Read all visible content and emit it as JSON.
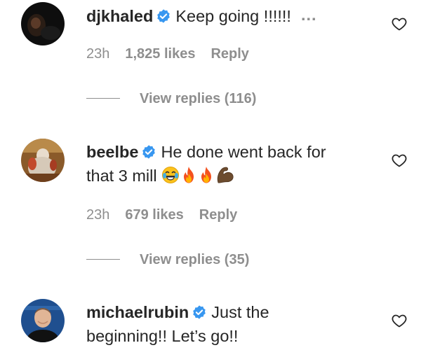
{
  "colors": {
    "text": "#262626",
    "secondary": "#8e8e8e",
    "verified": "#3897f0"
  },
  "comments": [
    {
      "username": "djkhaled",
      "verified": true,
      "text": "Keep going !!!!!!",
      "more": "...",
      "time": "23h",
      "likes": "1,825 likes",
      "reply": "Reply",
      "view_replies": "View replies (116)",
      "heart_icon": "heart-outline-icon"
    },
    {
      "username": "beelbe",
      "verified": true,
      "text_line1": "He done went back for",
      "text_line2": "that 3 mill",
      "emojis": [
        "face-with-tears-of-joy",
        "fire",
        "fire",
        "flexed-biceps"
      ],
      "time": "23h",
      "likes": "679 likes",
      "reply": "Reply",
      "view_replies": "View replies (35)",
      "heart_icon": "heart-outline-icon"
    },
    {
      "username": "michaelrubin",
      "verified": true,
      "text_line1": "Just the",
      "text_line2": "beginning!! Let’s go!!",
      "heart_icon": "heart-outline-icon"
    }
  ]
}
